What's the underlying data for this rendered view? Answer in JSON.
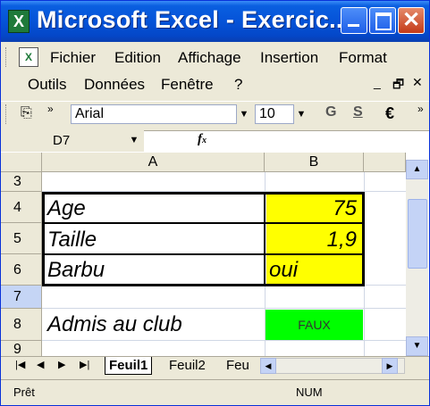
{
  "window": {
    "title": "Microsoft Excel - Exercic...",
    "app_icon": "X"
  },
  "menu": {
    "row1": [
      {
        "label": "Fichier"
      },
      {
        "label": "Edition"
      },
      {
        "label": "Affichage"
      },
      {
        "label": "Insertion"
      },
      {
        "label": "Format"
      }
    ],
    "row2": [
      {
        "label": "Outils"
      },
      {
        "label": "Données"
      },
      {
        "label": "Fenêtre"
      },
      {
        "label": "?"
      }
    ]
  },
  "toolbar": {
    "font_name": "Arial",
    "font_size": "10",
    "bold": "G",
    "underline": "S",
    "currency": "€"
  },
  "formula_bar": {
    "name_box": "D7",
    "fx": "fx",
    "content": ""
  },
  "grid": {
    "col_headers": [
      "A",
      "B"
    ],
    "rows": [
      {
        "num": "3"
      },
      {
        "num": "4",
        "a": "Age",
        "b": "75"
      },
      {
        "num": "5",
        "a": "Taille",
        "b": "1,9"
      },
      {
        "num": "6",
        "a": "Barbu",
        "b": "oui"
      },
      {
        "num": "7"
      },
      {
        "num": "8",
        "a": "Admis au club",
        "b": "FAUX"
      },
      {
        "num": "9"
      }
    ]
  },
  "sheets": {
    "tabs": [
      "Feuil1",
      "Feuil2",
      "Feu"
    ],
    "active": "Feuil1"
  },
  "status": {
    "left": "Prêt",
    "indicator": "NUM"
  },
  "colors": {
    "input_fill": "#ffff00",
    "result_fill": "#00ff00",
    "title_bar": "#0553d8"
  }
}
